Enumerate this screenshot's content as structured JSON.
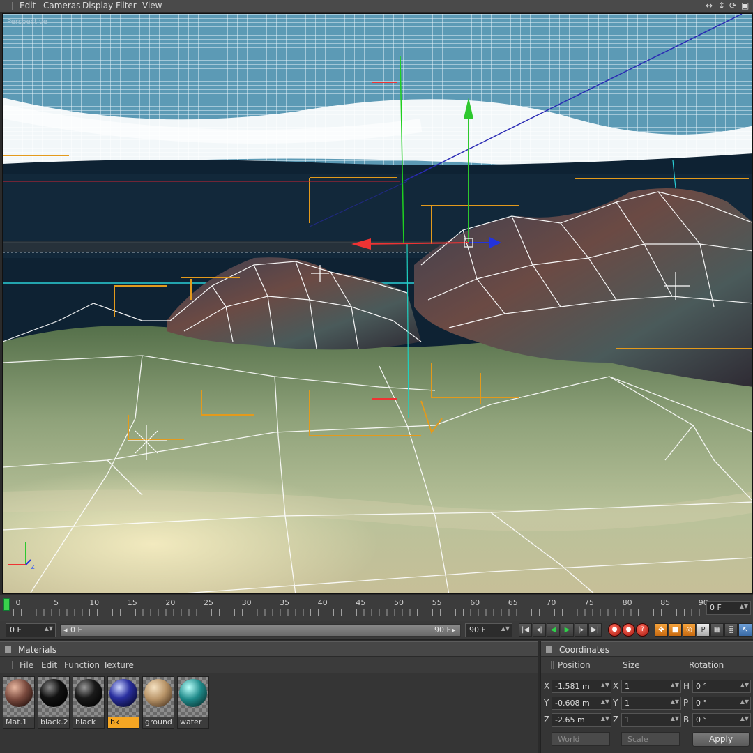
{
  "menubar": {
    "items": [
      "Edit",
      "Cameras",
      "Display",
      "Filter",
      "View"
    ],
    "window_controls": [
      "↔",
      "↕",
      "⟳",
      "▣"
    ]
  },
  "viewport": {
    "label": "Perspective",
    "colors": {
      "sky": "#d8ecf5",
      "deep": "#0e2233",
      "seafloor": "#bfc9a0",
      "rock": "#5a4a4a",
      "wire": "#ffffff",
      "axis_x": "#e33",
      "axis_y": "#2c2",
      "axis_z": "#22c",
      "light": "#e39a1c"
    }
  },
  "timeline": {
    "ruler_labels": [
      "0",
      "5",
      "10",
      "15",
      "20",
      "25",
      "30",
      "35",
      "40",
      "45",
      "50",
      "55",
      "60",
      "65",
      "70",
      "75",
      "80",
      "85",
      "90"
    ],
    "current_frame": "0 F",
    "start_field": "0 F",
    "range_start": "0 F",
    "range_end": "90 F",
    "end_field": "90 F"
  },
  "transport": {
    "buttons": [
      "go-to-start",
      "prev-key",
      "play-backward",
      "play-forward",
      "next-key",
      "go-to-end"
    ],
    "record_buttons": [
      "record",
      "autokey",
      "keyframe-selection"
    ],
    "mode_buttons": [
      "move",
      "scale",
      "rotate",
      "parameter",
      "pla"
    ]
  },
  "materials": {
    "title": "Materials",
    "menu": [
      "File",
      "Edit",
      "Function",
      "Texture"
    ],
    "items": [
      {
        "name": "Mat.1",
        "color": "#7a4a3e"
      },
      {
        "name": "black.2",
        "color": "#111111"
      },
      {
        "name": "black",
        "color": "#1a1a1a"
      },
      {
        "name": "bk",
        "color": "#1a1f6a",
        "selected": true
      },
      {
        "name": "ground",
        "color": "#b89468"
      },
      {
        "name": "water",
        "color": "#1f8a8a"
      }
    ]
  },
  "coordinates": {
    "title": "Coordinates",
    "headers": [
      "Position",
      "Size",
      "Rotation"
    ],
    "rows": [
      {
        "pos_axis": "X",
        "pos": "-1.581 m",
        "size_axis": "X",
        "size": "1",
        "rot_axis": "H",
        "rot": "0 °"
      },
      {
        "pos_axis": "Y",
        "pos": "-0.608 m",
        "size_axis": "Y",
        "size": "1",
        "rot_axis": "P",
        "rot": "0 °"
      },
      {
        "pos_axis": "Z",
        "pos": "-2.65 m",
        "size_axis": "Z",
        "size": "1",
        "rot_axis": "B",
        "rot": "0 °"
      }
    ],
    "mode_dropdown": "World",
    "size_dropdown": "Scale",
    "apply_label": "Apply"
  }
}
